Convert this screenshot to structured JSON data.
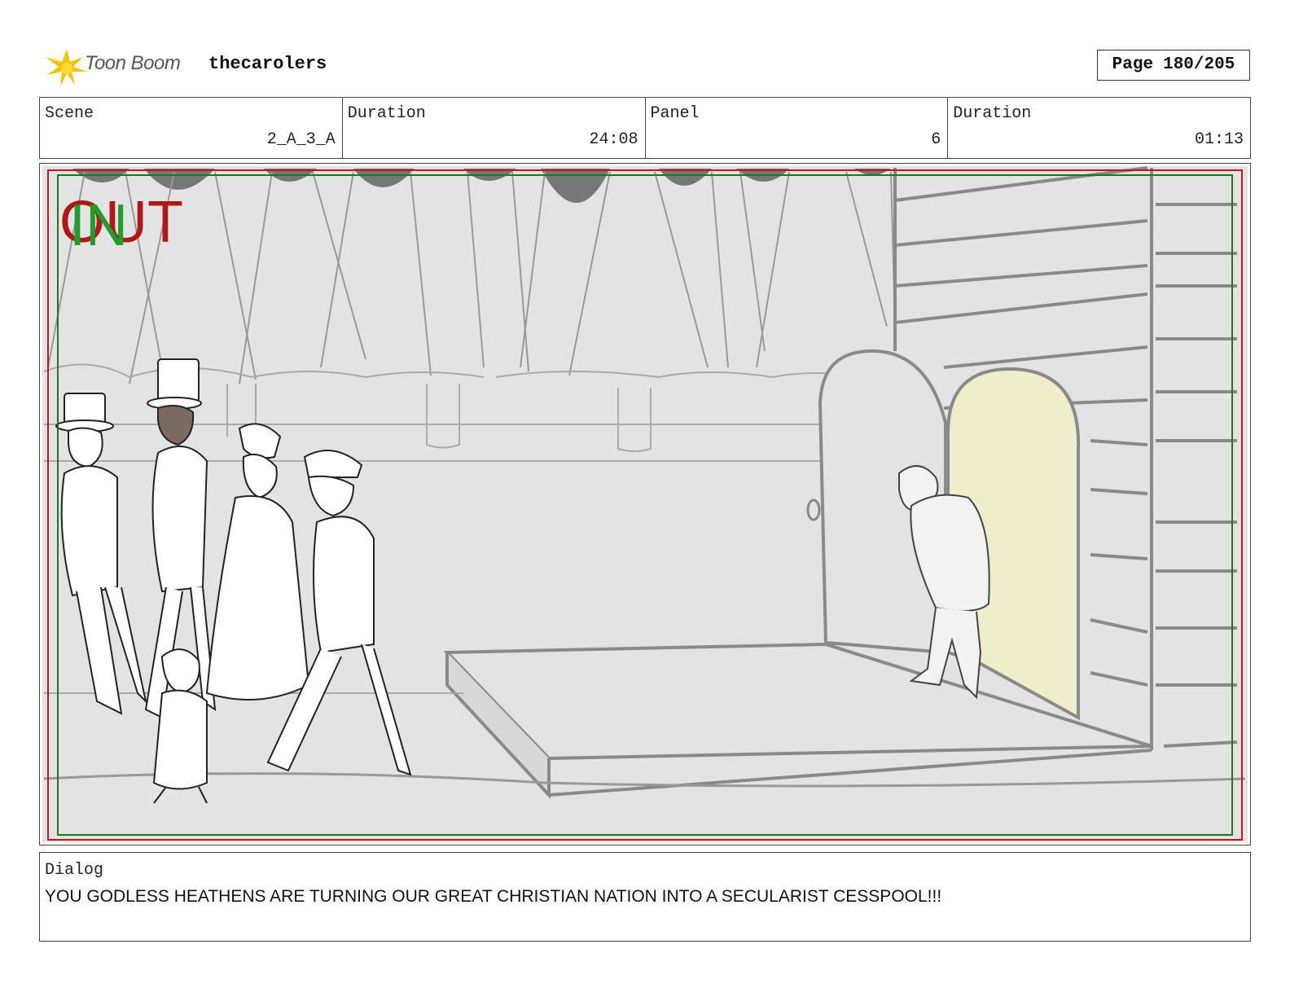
{
  "header": {
    "logo_text": "Toon Boom",
    "project_name": "thecarolers",
    "page_label": "Page",
    "page_number": "180/205"
  },
  "info": {
    "scene": {
      "label": "Scene",
      "value": "2_A_3_A"
    },
    "scene_duration": {
      "label": "Duration",
      "value": "24:08"
    },
    "panel": {
      "label": "Panel",
      "value": "6"
    },
    "panel_duration": {
      "label": "Duration",
      "value": "01:13"
    }
  },
  "panel_overlay": {
    "out_mark": "OUT",
    "in_mark": "IN",
    "out_color": "#b01818",
    "in_color": "#1e9e2a"
  },
  "colors": {
    "safe_frame_red": "#c0161c",
    "safe_frame_green": "#1a7a1a",
    "door_fill": "#eeeecc",
    "sketch_gray": "#8a8a8a"
  },
  "dialog": {
    "label": "Dialog",
    "text": "YOU GODLESS HEATHENS ARE TURNING OUR GREAT CHRISTIAN NATION INTO A SECULARIST CESSPOOL!!!"
  }
}
